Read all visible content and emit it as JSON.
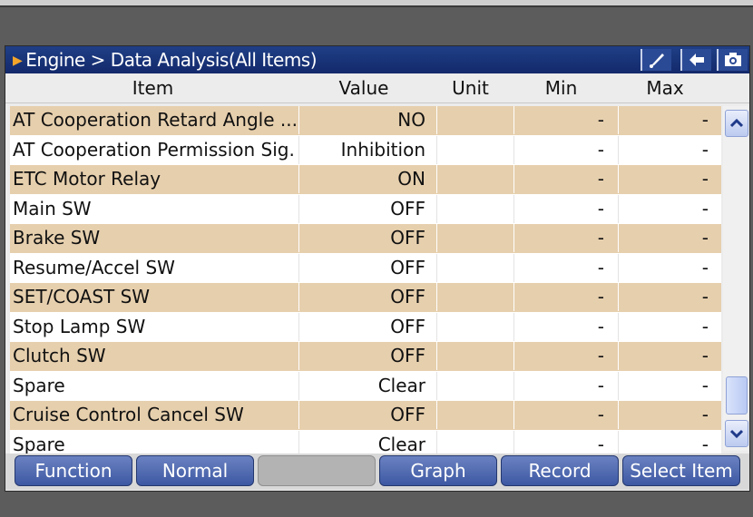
{
  "header": {
    "breadcrumb": "Engine > Data Analysis(All Items)",
    "icons": [
      "brush-icon",
      "back-arrow-icon",
      "camera-icon"
    ]
  },
  "columns": [
    "Item",
    "Value",
    "Unit",
    "Min",
    "Max"
  ],
  "rows": [
    {
      "item": "AT Cooperation Retard Angle ...",
      "value": "NO",
      "unit": "",
      "min": "-",
      "max": "-"
    },
    {
      "item": "AT Cooperation Permission Sig...",
      "value": "Inhibition",
      "unit": "",
      "min": "-",
      "max": "-"
    },
    {
      "item": "ETC Motor Relay",
      "value": "ON",
      "unit": "",
      "min": "-",
      "max": "-"
    },
    {
      "item": "Main SW",
      "value": "OFF",
      "unit": "",
      "min": "-",
      "max": "-"
    },
    {
      "item": "Brake SW",
      "value": "OFF",
      "unit": "",
      "min": "-",
      "max": "-"
    },
    {
      "item": "Resume/Accel SW",
      "value": "OFF",
      "unit": "",
      "min": "-",
      "max": "-"
    },
    {
      "item": "SET/COAST SW",
      "value": "OFF",
      "unit": "",
      "min": "-",
      "max": "-"
    },
    {
      "item": "Stop Lamp SW",
      "value": "OFF",
      "unit": "",
      "min": "-",
      "max": "-"
    },
    {
      "item": "Clutch SW",
      "value": "OFF",
      "unit": "",
      "min": "-",
      "max": "-"
    },
    {
      "item": "Spare",
      "value": "Clear",
      "unit": "",
      "min": "-",
      "max": "-"
    },
    {
      "item": "Cruise Control Cancel SW",
      "value": "OFF",
      "unit": "",
      "min": "-",
      "max": "-"
    },
    {
      "item": "Spare",
      "value": "Clear",
      "unit": "",
      "min": "-",
      "max": "-"
    }
  ],
  "footer": {
    "function": "Function",
    "normal": "Normal",
    "blank": "",
    "graph": "Graph",
    "record": "Record",
    "select_item": "Select Item"
  },
  "colors": {
    "title_bar": "#13296b",
    "row_highlight": "#e6cfad",
    "button": "#4a64ae",
    "accent_arrow": "#f3a52a"
  }
}
